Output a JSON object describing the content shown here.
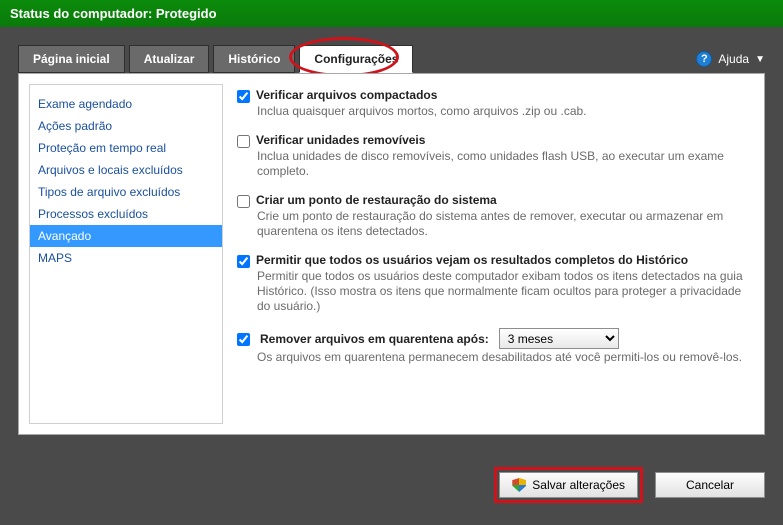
{
  "header": {
    "status": "Status do computador: Protegido"
  },
  "tabs": {
    "home": "Página inicial",
    "update": "Atualizar",
    "history": "Histórico",
    "settings": "Configurações"
  },
  "help": {
    "label": "Ajuda"
  },
  "sidebar": {
    "items": [
      "Exame agendado",
      "Ações padrão",
      "Proteção em tempo real",
      "Arquivos e locais excluídos",
      "Tipos de arquivo excluídos",
      "Processos excluídos",
      "Avançado",
      "MAPS"
    ],
    "selected_index": 6
  },
  "options": {
    "scan_archive": {
      "checked": true,
      "title": "Verificar arquivos compactados",
      "desc": "Inclua quaisquer arquivos mortos, como arquivos .zip ou .cab."
    },
    "scan_removable": {
      "checked": false,
      "title": "Verificar unidades removíveis",
      "desc": "Inclua unidades de disco removíveis, como unidades flash USB, ao executar um exame completo."
    },
    "restore_point": {
      "checked": false,
      "title": "Criar um ponto de restauração do sistema",
      "desc": "Crie um ponto de restauração do sistema antes de remover, executar ou armazenar em quarentena os itens detectados."
    },
    "allow_all_users": {
      "checked": true,
      "title": "Permitir que todos os usuários vejam os resultados completos do Histórico",
      "desc": "Permitir que todos os usuários deste computador exibam todos os itens detectados na guia Histórico. (Isso mostra os itens que normalmente ficam ocultos para proteger a privacidade do usuário.)"
    },
    "remove_quarantine": {
      "checked": true,
      "title": "Remover arquivos em quarentena após:",
      "value": "3 meses",
      "desc": "Os arquivos em quarentena permanecem desabilitados até você permiti-los ou removê-los."
    }
  },
  "buttons": {
    "save": "Salvar alterações",
    "cancel": "Cancelar"
  }
}
